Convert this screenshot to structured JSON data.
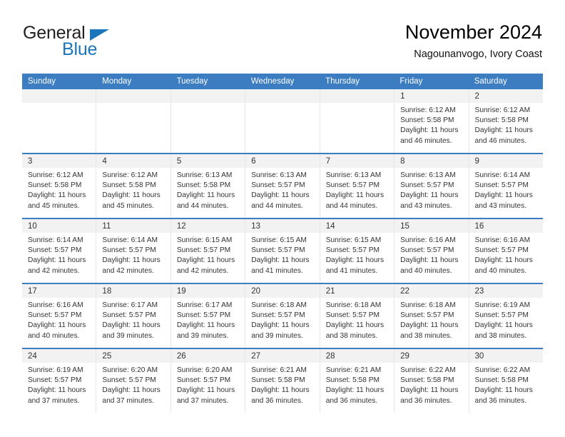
{
  "brand": {
    "name_part1": "General",
    "name_part2": "Blue"
  },
  "header": {
    "title": "November 2024",
    "subtitle": "Nagounanvogo, Ivory Coast"
  },
  "colors": {
    "header_blue": "#3b7dc0",
    "brand_blue": "#1b75bb",
    "daynum_band": "#f2f2f2",
    "cell_border": "#e6e6e6"
  },
  "weekdays": [
    "Sunday",
    "Monday",
    "Tuesday",
    "Wednesday",
    "Thursday",
    "Friday",
    "Saturday"
  ],
  "weeks": [
    [
      {
        "day": "",
        "empty": true,
        "lines": []
      },
      {
        "day": "",
        "empty": true,
        "lines": []
      },
      {
        "day": "",
        "empty": true,
        "lines": []
      },
      {
        "day": "",
        "empty": true,
        "lines": []
      },
      {
        "day": "",
        "empty": true,
        "lines": []
      },
      {
        "day": "1",
        "sunrise": "Sunrise: 6:12 AM",
        "sunset": "Sunset: 5:58 PM",
        "daylight1": "Daylight: 11 hours",
        "daylight2": "and 46 minutes."
      },
      {
        "day": "2",
        "sunrise": "Sunrise: 6:12 AM",
        "sunset": "Sunset: 5:58 PM",
        "daylight1": "Daylight: 11 hours",
        "daylight2": "and 46 minutes."
      }
    ],
    [
      {
        "day": "3",
        "sunrise": "Sunrise: 6:12 AM",
        "sunset": "Sunset: 5:58 PM",
        "daylight1": "Daylight: 11 hours",
        "daylight2": "and 45 minutes."
      },
      {
        "day": "4",
        "sunrise": "Sunrise: 6:12 AM",
        "sunset": "Sunset: 5:58 PM",
        "daylight1": "Daylight: 11 hours",
        "daylight2": "and 45 minutes."
      },
      {
        "day": "5",
        "sunrise": "Sunrise: 6:13 AM",
        "sunset": "Sunset: 5:58 PM",
        "daylight1": "Daylight: 11 hours",
        "daylight2": "and 44 minutes."
      },
      {
        "day": "6",
        "sunrise": "Sunrise: 6:13 AM",
        "sunset": "Sunset: 5:57 PM",
        "daylight1": "Daylight: 11 hours",
        "daylight2": "and 44 minutes."
      },
      {
        "day": "7",
        "sunrise": "Sunrise: 6:13 AM",
        "sunset": "Sunset: 5:57 PM",
        "daylight1": "Daylight: 11 hours",
        "daylight2": "and 44 minutes."
      },
      {
        "day": "8",
        "sunrise": "Sunrise: 6:13 AM",
        "sunset": "Sunset: 5:57 PM",
        "daylight1": "Daylight: 11 hours",
        "daylight2": "and 43 minutes."
      },
      {
        "day": "9",
        "sunrise": "Sunrise: 6:14 AM",
        "sunset": "Sunset: 5:57 PM",
        "daylight1": "Daylight: 11 hours",
        "daylight2": "and 43 minutes."
      }
    ],
    [
      {
        "day": "10",
        "sunrise": "Sunrise: 6:14 AM",
        "sunset": "Sunset: 5:57 PM",
        "daylight1": "Daylight: 11 hours",
        "daylight2": "and 42 minutes."
      },
      {
        "day": "11",
        "sunrise": "Sunrise: 6:14 AM",
        "sunset": "Sunset: 5:57 PM",
        "daylight1": "Daylight: 11 hours",
        "daylight2": "and 42 minutes."
      },
      {
        "day": "12",
        "sunrise": "Sunrise: 6:15 AM",
        "sunset": "Sunset: 5:57 PM",
        "daylight1": "Daylight: 11 hours",
        "daylight2": "and 42 minutes."
      },
      {
        "day": "13",
        "sunrise": "Sunrise: 6:15 AM",
        "sunset": "Sunset: 5:57 PM",
        "daylight1": "Daylight: 11 hours",
        "daylight2": "and 41 minutes."
      },
      {
        "day": "14",
        "sunrise": "Sunrise: 6:15 AM",
        "sunset": "Sunset: 5:57 PM",
        "daylight1": "Daylight: 11 hours",
        "daylight2": "and 41 minutes."
      },
      {
        "day": "15",
        "sunrise": "Sunrise: 6:16 AM",
        "sunset": "Sunset: 5:57 PM",
        "daylight1": "Daylight: 11 hours",
        "daylight2": "and 40 minutes."
      },
      {
        "day": "16",
        "sunrise": "Sunrise: 6:16 AM",
        "sunset": "Sunset: 5:57 PM",
        "daylight1": "Daylight: 11 hours",
        "daylight2": "and 40 minutes."
      }
    ],
    [
      {
        "day": "17",
        "sunrise": "Sunrise: 6:16 AM",
        "sunset": "Sunset: 5:57 PM",
        "daylight1": "Daylight: 11 hours",
        "daylight2": "and 40 minutes."
      },
      {
        "day": "18",
        "sunrise": "Sunrise: 6:17 AM",
        "sunset": "Sunset: 5:57 PM",
        "daylight1": "Daylight: 11 hours",
        "daylight2": "and 39 minutes."
      },
      {
        "day": "19",
        "sunrise": "Sunrise: 6:17 AM",
        "sunset": "Sunset: 5:57 PM",
        "daylight1": "Daylight: 11 hours",
        "daylight2": "and 39 minutes."
      },
      {
        "day": "20",
        "sunrise": "Sunrise: 6:18 AM",
        "sunset": "Sunset: 5:57 PM",
        "daylight1": "Daylight: 11 hours",
        "daylight2": "and 39 minutes."
      },
      {
        "day": "21",
        "sunrise": "Sunrise: 6:18 AM",
        "sunset": "Sunset: 5:57 PM",
        "daylight1": "Daylight: 11 hours",
        "daylight2": "and 38 minutes."
      },
      {
        "day": "22",
        "sunrise": "Sunrise: 6:18 AM",
        "sunset": "Sunset: 5:57 PM",
        "daylight1": "Daylight: 11 hours",
        "daylight2": "and 38 minutes."
      },
      {
        "day": "23",
        "sunrise": "Sunrise: 6:19 AM",
        "sunset": "Sunset: 5:57 PM",
        "daylight1": "Daylight: 11 hours",
        "daylight2": "and 38 minutes."
      }
    ],
    [
      {
        "day": "24",
        "sunrise": "Sunrise: 6:19 AM",
        "sunset": "Sunset: 5:57 PM",
        "daylight1": "Daylight: 11 hours",
        "daylight2": "and 37 minutes."
      },
      {
        "day": "25",
        "sunrise": "Sunrise: 6:20 AM",
        "sunset": "Sunset: 5:57 PM",
        "daylight1": "Daylight: 11 hours",
        "daylight2": "and 37 minutes."
      },
      {
        "day": "26",
        "sunrise": "Sunrise: 6:20 AM",
        "sunset": "Sunset: 5:57 PM",
        "daylight1": "Daylight: 11 hours",
        "daylight2": "and 37 minutes."
      },
      {
        "day": "27",
        "sunrise": "Sunrise: 6:21 AM",
        "sunset": "Sunset: 5:58 PM",
        "daylight1": "Daylight: 11 hours",
        "daylight2": "and 36 minutes."
      },
      {
        "day": "28",
        "sunrise": "Sunrise: 6:21 AM",
        "sunset": "Sunset: 5:58 PM",
        "daylight1": "Daylight: 11 hours",
        "daylight2": "and 36 minutes."
      },
      {
        "day": "29",
        "sunrise": "Sunrise: 6:22 AM",
        "sunset": "Sunset: 5:58 PM",
        "daylight1": "Daylight: 11 hours",
        "daylight2": "and 36 minutes."
      },
      {
        "day": "30",
        "sunrise": "Sunrise: 6:22 AM",
        "sunset": "Sunset: 5:58 PM",
        "daylight1": "Daylight: 11 hours",
        "daylight2": "and 36 minutes."
      }
    ]
  ]
}
